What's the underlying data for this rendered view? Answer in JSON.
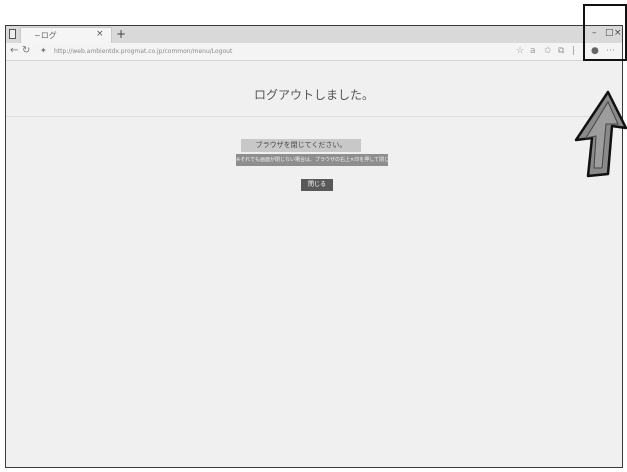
{
  "browser": {
    "tab_title": "~ログ",
    "tab_close": "×",
    "new_tab": "+",
    "window_controls": {
      "minimize": "–",
      "maximize": "□",
      "close": "×"
    },
    "url": "http://web.ambientdx.progmat.co.jp/common/menu/Logout"
  },
  "page": {
    "title": "ログアウトしました。",
    "banner": "ブラウザを閉じてください。",
    "notice": "※それでも画面が閉じない場合は、ブラウザの右上×印を押して閉じてください。",
    "close_button": "閉じる"
  },
  "colors": {
    "annotation": "#111111",
    "arrow_fill": "#8a8a8a",
    "banner_bg": "#c8c8c8",
    "notice_bg": "#8e8e8e",
    "button_bg": "#595959"
  },
  "icons": [
    "tab-stack-icon",
    "back-arrow-icon",
    "refresh-icon",
    "lock-icon",
    "favorite-icon",
    "collections-icon",
    "profile-icon",
    "menu-icon",
    "pointer-arrow"
  ]
}
